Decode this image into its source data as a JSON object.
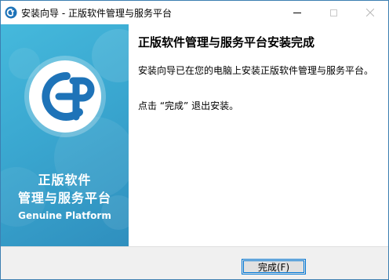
{
  "window": {
    "title": "安装向导 - 正版软件管理与服务平台",
    "app_icon": "gp-logo-icon",
    "controls": {
      "minimize": "minimize-icon",
      "maximize": "maximize-icon",
      "close": "close-icon"
    }
  },
  "sidebar": {
    "logo": "gp-logo",
    "title_line1": "正版软件",
    "title_line2": "管理与服务平台",
    "subtitle": "Genuine Platform",
    "colors": {
      "gradient_start": "#45b9dc",
      "gradient_end": "#2f8fbe"
    }
  },
  "content": {
    "heading": "正版软件管理与服务平台安装完成",
    "paragraph1": "安装向导已在您的电脑上安装正版软件管理与服务平台。",
    "paragraph2": "点击 “完成” 退出安装。"
  },
  "footer": {
    "finish_button": "完成(F)"
  },
  "colors": {
    "accent": "#0078d7",
    "logo_blue": "#1e73b8"
  }
}
